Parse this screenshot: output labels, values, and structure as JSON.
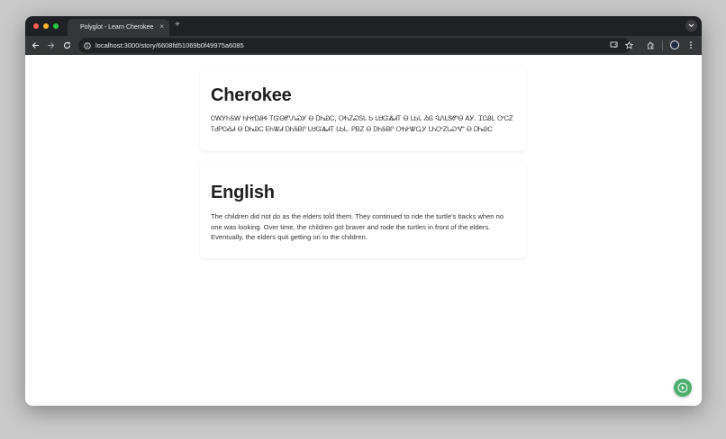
{
  "browser": {
    "tab_title": "Polyglot - Learn Cherokee",
    "tab_close": "×",
    "new_tab": "+",
    "url": "localhost:3000/story/6608fd51069b0f49975a6085"
  },
  "colors": {
    "chrome_dark": "#202124",
    "toolbar": "#35363a",
    "fab_green": "#4caf6e"
  },
  "icons": [
    "back-icon",
    "forward-icon",
    "reload-icon",
    "site-info-icon",
    "cast-icon",
    "bookmark-star-icon",
    "extensions-icon",
    "profile-avatar",
    "more-menu-icon",
    "play-icon"
  ],
  "sections": [
    {
      "heading": "Cherokee",
      "body": "ᏣᎳᎩᏂᎦᎳ ᏂᎨᏥᎠᏰᏎ ᎢᏳᎾᏛᏁᏍᎩ Ꮎ ᎠᏂᏯᏟ, ᎤᏂᏃᏍᏚᏓ Ꮟ ᏓᏌᏳᏜᏗᎢ Ꮎ ᏓᏏᏓ ᏱᎶ ᏄᏁᏓᏕᏛᎾ ᎪᎩ. ᏆᏣᏰᏞ ᏅᏟᏃ ᎢᏧᏢᏣᎣᏗ Ꮎ ᎠᏂᏯᏟ ᎬᏂᏔᏗ ᎠᏂᎦᏴᎵ ᏓᏌᏳᏜᏗᎢ ᏓᏏᏓ. ᏢᏴᏃ Ꮎ ᎠᏂᎦᏴᎵ ᎤᏂᎨᏔᏩᎩ ᏓᏂᏅᏃᏓᏍᏉ Ꮎ ᎠᏂᏯᏟ"
    },
    {
      "heading": "English",
      "body": "The children did not do as the elders told them. They continued to ride the turtle's backs when no one was looking. Over time, the children got braver and rode the turtles in front of the elders. Eventually, the elders quit getting on to the children."
    }
  ]
}
